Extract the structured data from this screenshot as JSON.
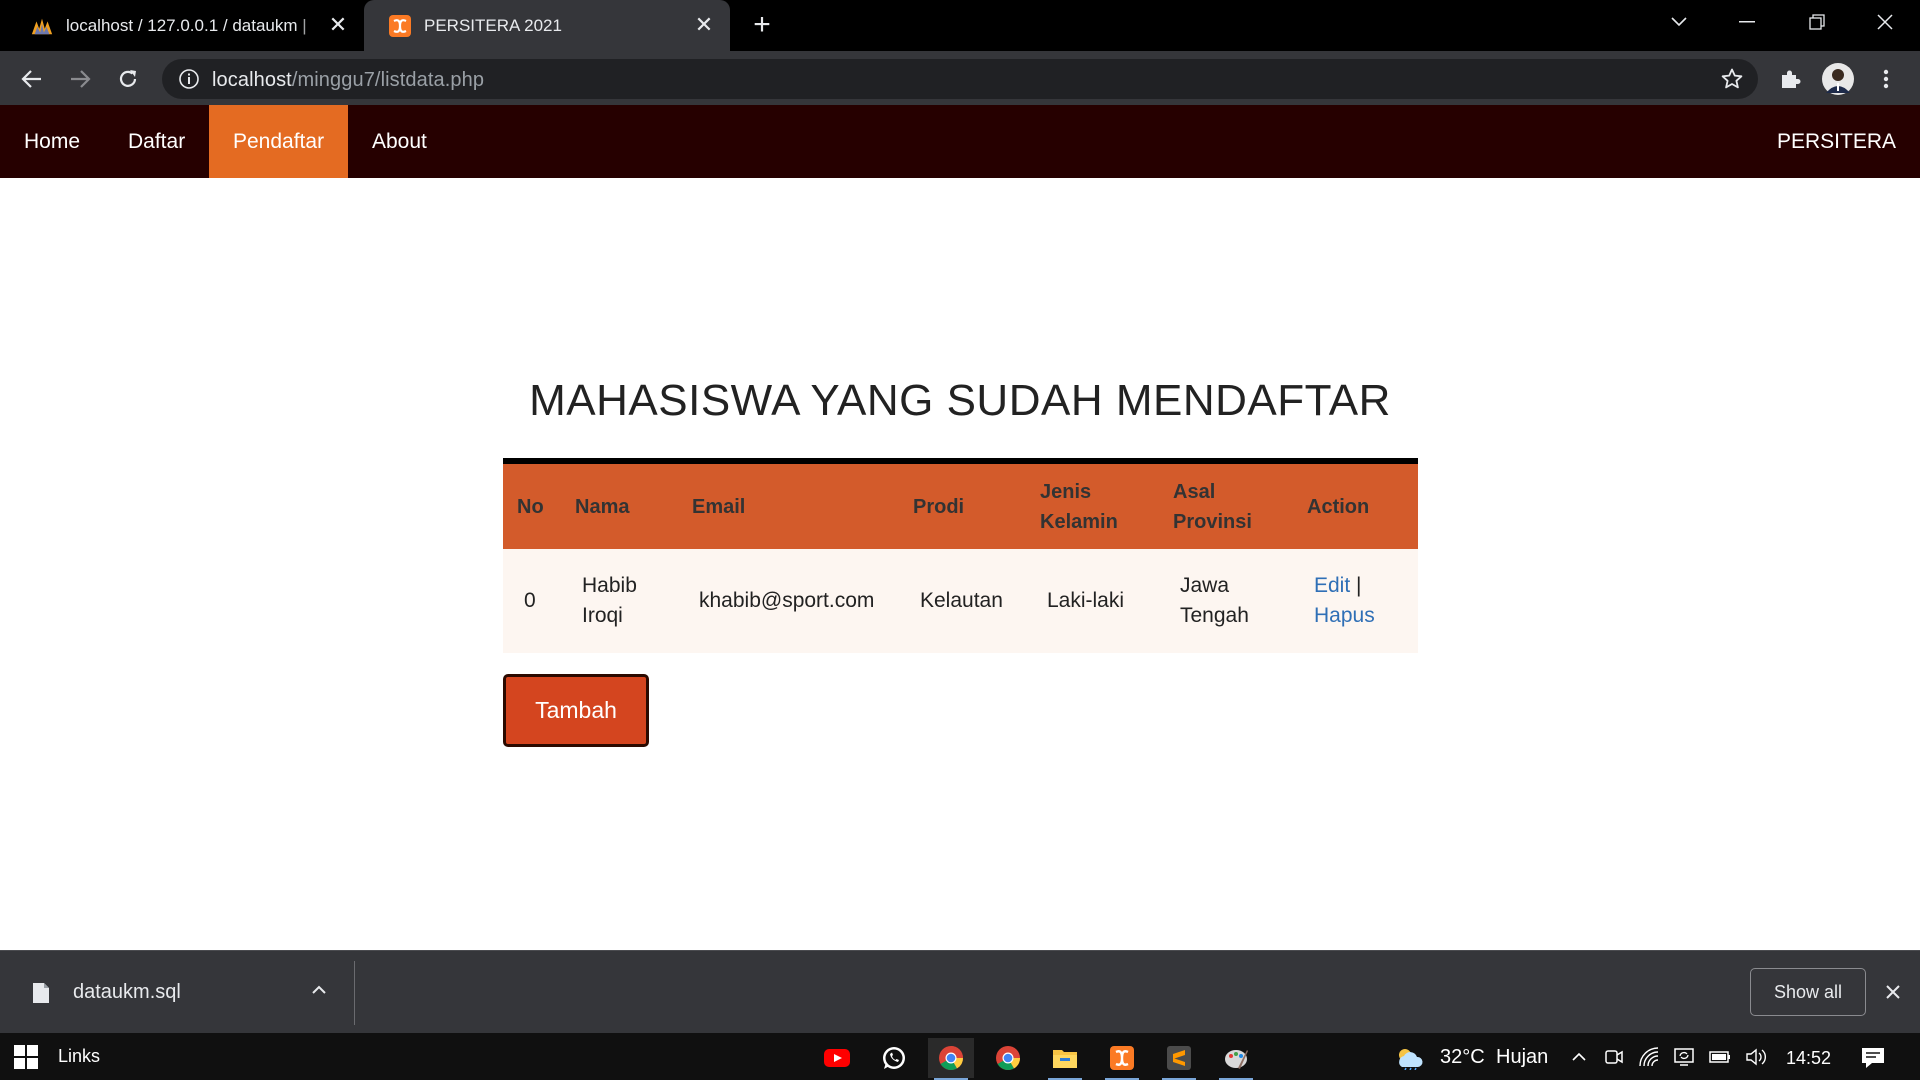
{
  "browser": {
    "tabs": [
      {
        "title": "localhost / 127.0.0.1 / dataukm | ",
        "icon": "phpmyadmin-icon"
      },
      {
        "title": "PERSITERA 2021",
        "icon": "xampp-icon"
      }
    ],
    "address": {
      "host": "localhost",
      "path": "/minggu7/listdata.php"
    }
  },
  "navbar": {
    "links": [
      "Home",
      "Daftar",
      "Pendaftar",
      "About"
    ],
    "active": "Pendaftar",
    "brand": "PERSITERA",
    "colors": {
      "background": "#260000",
      "active": "#e46b22"
    }
  },
  "main": {
    "title": "MAHASISWA YANG SUDAH MENDAFTAR",
    "table": {
      "headers": [
        "No",
        "Nama",
        "Email",
        "Prodi",
        "Jenis Kelamin",
        "Asal Provinsi",
        "Action"
      ],
      "rows": [
        {
          "no": "0",
          "nama": "Habib Iroqi",
          "email": "khabib@sport.com",
          "prodi": "Kelautan",
          "jenis_kelamin": "Laki-laki",
          "asal_provinsi": "Jawa Tengah",
          "edit": "Edit",
          "separator": "|",
          "hapus": "Hapus"
        }
      ]
    },
    "add_button": "Tambah",
    "colors": {
      "header": "#d35b2b",
      "row": "#fdf6f1",
      "button": "#d4451f",
      "link": "#2f6fb6"
    }
  },
  "downloads": {
    "file": "dataukm.sql",
    "show_all": "Show all"
  },
  "taskbar": {
    "links_label": "Links",
    "apps": [
      "youtube-icon",
      "whatsapp-icon",
      "chrome-icon",
      "chrome-icon",
      "file-explorer-icon",
      "xampp-icon",
      "sublime-text-icon",
      "paint-icon"
    ],
    "weather": {
      "temp": "32°C",
      "condition": "Hujan"
    },
    "time": "14:52"
  }
}
